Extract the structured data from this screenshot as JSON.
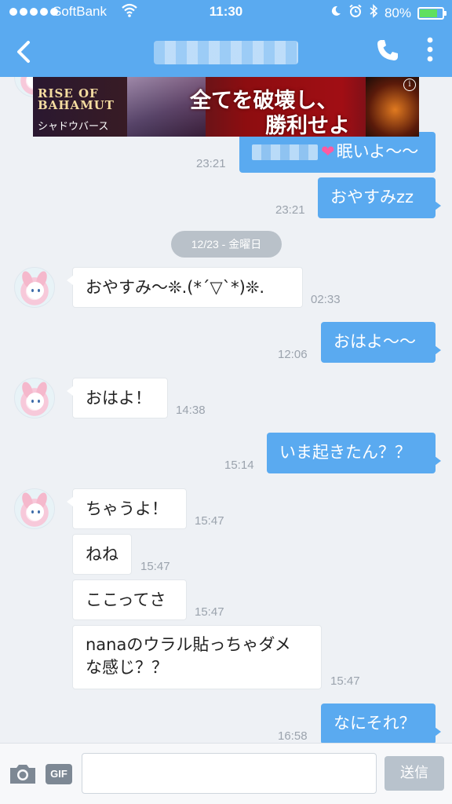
{
  "status_bar": {
    "carrier": "SoftBank",
    "time": "11:30",
    "battery_percent": "80%",
    "battery_level": 0.8
  },
  "header": {
    "back_icon": "chevron-left-icon",
    "call_icon": "phone-icon",
    "menu_icon": "more-vertical-icon"
  },
  "ad": {
    "logo": "RISE OF BAHAMUT",
    "subtitle": "シャドウバース",
    "copy_line1": "全てを破壊し、",
    "copy_line2": "勝利せよ",
    "info": "i"
  },
  "messages": [
    {
      "side": "out",
      "text": "眠いよ〜〜",
      "time": "23:21"
    },
    {
      "side": "out",
      "text": "おやすみzz",
      "time": "23:21"
    },
    {
      "side": "date",
      "text": "12/23 - 金曜日"
    },
    {
      "side": "in",
      "text": "おやすみ〜❊.(*´▽`*)❊.",
      "time": "02:33"
    },
    {
      "side": "out",
      "text": "おはよ〜〜",
      "time": "12:06"
    },
    {
      "side": "in",
      "text": "おはよ！",
      "time": "14:38"
    },
    {
      "side": "out",
      "text": "いま起きたん？？",
      "time": "15:14"
    },
    {
      "side": "in",
      "text": "ちゃうよ！",
      "time": "15:47"
    },
    {
      "side": "in",
      "text": "ねね",
      "time": "15:47"
    },
    {
      "side": "in",
      "text": "ここってさ",
      "time": "15:47"
    },
    {
      "side": "in",
      "text_line1": "nanaのウラル貼っちゃダメ",
      "text_line2": "な感じ？？",
      "time": "15:47"
    },
    {
      "side": "out",
      "text": "なにそれ？",
      "time": "16:58"
    }
  ],
  "input_bar": {
    "camera_icon": "camera-icon",
    "gif_label": "GIF",
    "message_value": "",
    "send_label": "送信"
  },
  "colors": {
    "accent": "#5aaaf0",
    "background": "#eef1f5",
    "send_disabled": "#b8c2cc"
  }
}
